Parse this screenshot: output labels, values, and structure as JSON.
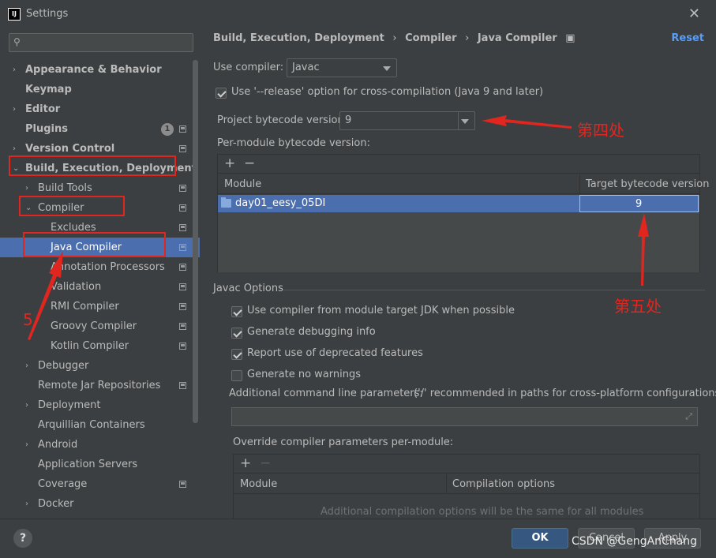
{
  "window": {
    "title": "Settings",
    "app_icon_text": "IJ"
  },
  "search": {
    "placeholder": ""
  },
  "sidebar": {
    "items": [
      {
        "label": "Appearance & Behavior",
        "bold": true,
        "arrow": "›"
      },
      {
        "label": "Keymap",
        "bold": true,
        "arrow": ""
      },
      {
        "label": "Editor",
        "bold": true,
        "arrow": "›"
      },
      {
        "label": "Plugins",
        "bold": true,
        "arrow": "",
        "badge": "1"
      },
      {
        "label": "Version Control",
        "bold": true,
        "arrow": "›"
      },
      {
        "label": "Build, Execution, Deployment",
        "bold": true,
        "arrow": "⌄"
      },
      {
        "label": "Build Tools",
        "arrow": "›"
      },
      {
        "label": "Compiler",
        "arrow": "⌄"
      },
      {
        "label": "Excludes",
        "arrow": ""
      },
      {
        "label": "Java Compiler",
        "arrow": "",
        "selected": true
      },
      {
        "label": "Annotation Processors",
        "arrow": ""
      },
      {
        "label": "Validation",
        "arrow": ""
      },
      {
        "label": "RMI Compiler",
        "arrow": ""
      },
      {
        "label": "Groovy Compiler",
        "arrow": ""
      },
      {
        "label": "Kotlin Compiler",
        "arrow": ""
      },
      {
        "label": "Debugger",
        "arrow": "›"
      },
      {
        "label": "Remote Jar Repositories",
        "arrow": ""
      },
      {
        "label": "Deployment",
        "arrow": "›"
      },
      {
        "label": "Arquillian Containers",
        "arrow": ""
      },
      {
        "label": "Android",
        "arrow": "›"
      },
      {
        "label": "Application Servers",
        "arrow": ""
      },
      {
        "label": "Coverage",
        "arrow": ""
      },
      {
        "label": "Docker",
        "arrow": "›"
      }
    ]
  },
  "breadcrumb": {
    "parts": [
      "Build, Execution, Deployment",
      "Compiler",
      "Java Compiler"
    ],
    "separator": "›",
    "reset_label": "Reset"
  },
  "main": {
    "use_compiler_label": "Use compiler:",
    "use_compiler_value": "Javac",
    "release_option_label": "Use '--release' option for cross-compilation (Java 9 and later)",
    "project_bytecode_label": "Project bytecode version:",
    "project_bytecode_value": "9",
    "per_module_label": "Per-module bytecode version:",
    "module_table": {
      "col_module": "Module",
      "col_target": "Target bytecode version",
      "rows": [
        {
          "module": "day01_eesy_05DI",
          "target": "9"
        }
      ]
    },
    "javac_options_title": "Javac Options",
    "opt_module_jdk": "Use compiler from module target JDK when possible",
    "opt_debug_info": "Generate debugging info",
    "opt_deprecated": "Report use of deprecated features",
    "opt_no_warnings": "Generate no warnings",
    "additional_params_label": "Additional command line parameters:",
    "additional_params_hint": "('/' recommended in paths for cross-platform configurations)",
    "override_label": "Override compiler parameters per-module:",
    "override_table": {
      "col_module": "Module",
      "col_options": "Compilation options",
      "empty_text": "Additional compilation options will be the same for all modules"
    },
    "plus_glyph": "+",
    "minus_glyph": "−"
  },
  "footer": {
    "help_glyph": "?",
    "ok_label": "OK",
    "cancel_label": "Cancel",
    "apply_label": "Apply",
    "watermark": "CSDN @GengAnChang"
  },
  "annotations": {
    "label_fourth": "第四处",
    "label_fifth": "第五处",
    "label_five": "5",
    "color": "#e0261f"
  }
}
